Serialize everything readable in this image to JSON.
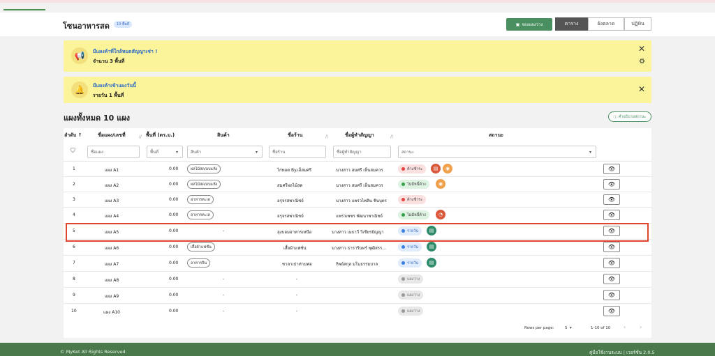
{
  "header": {
    "title": "โซนอาหารสด",
    "badge": "10 พื้นที่",
    "book_label": "จองแผงว่าง",
    "views": [
      "ตาราง",
      "ผังตลาด",
      "ปฏิทิน"
    ]
  },
  "banners": [
    {
      "title": "มีแผงค้าที่ใกล้หมดสัญญาเช่า !",
      "subtitle": "จำนวน 3 พื้นที่",
      "icon": "megaphone-icon"
    },
    {
      "title": "มีแผงค้าเข้าแผงวันนี้",
      "subtitle": "รายวัน 1 พื้นที่",
      "icon": "bell-icon"
    }
  ],
  "section": {
    "title": "แผงทั้งหมด 10 แผง",
    "help_label": "คำอธิบายสถานะ"
  },
  "table": {
    "headers": {
      "order": "ลำดับ ↑",
      "stall": "ชื่อแผง/เลขที่",
      "area": "พื้นที่ (ตร.ม.)",
      "goods": "สินค้า",
      "shop": "ชื่อร้าน",
      "tenant": "ชื่อผู้ทำสัญญา",
      "status": "สถานะ"
    },
    "filters": {
      "stall": "ชื่อแผง",
      "area": "พื้นที่",
      "goods": "สินค้า",
      "shop": "ชื่อร้าน",
      "tenant": "ชื่อผู้ทำสัญญา",
      "status": "สถานะ"
    },
    "rows": [
      {
        "no": "1",
        "stall": "แผง A1",
        "area": "0.00",
        "goods": "ผลไม้สด/อบแห้ง",
        "shop": "ไก่ทอด By.เอ็สมศรี",
        "tenant": "นางสาว สมศรี เห็นสมควร",
        "status": "ค้างชำระ",
        "st": "pay"
      },
      {
        "no": "2",
        "stall": "แผง A2",
        "area": "0.00",
        "goods": "ผลไม้สด/อบแห้ง",
        "shop": "สมศรีผลไม้สด",
        "tenant": "นางสาว สมศรี เห็นสมควร",
        "status": "ไม่มีหนี้ค้าง",
        "st": "ok"
      },
      {
        "no": "3",
        "stall": "แผง A3",
        "area": "0.00",
        "goods": "อาหารทะเล",
        "shop": "อรุจรสพาณิชย์",
        "tenant": "นางสาว แพรวไพลิน ชินบุตร",
        "status": "ค้างชำระ",
        "st": "pay"
      },
      {
        "no": "4",
        "stall": "แผง A4",
        "area": "0.00",
        "goods": "อาหารทะเล",
        "shop": "อรุจรสพาณิชย์",
        "tenant": "แพรวเพชร พัฒนาพาณิชย์",
        "status": "ไม่มีหนี้ค้าง",
        "st": "ok"
      },
      {
        "no": "5",
        "stall": "แผง A5",
        "area": "0.00",
        "goods": "-",
        "shop": "ลุงบอมอาหารเหนือ",
        "tenant": "นางสาว เมธาวี วิเชียรปัญญา",
        "status": "รายวัน",
        "st": "day"
      },
      {
        "no": "6",
        "stall": "แผง A6",
        "area": "0.00",
        "goods": "เสื้อผ้าแฟชั่น",
        "shop": "เสื้อผ้าแฟชั่น",
        "tenant": "นางสาว ธารารินทร์ พุฒิสรร...",
        "status": "รายวัน",
        "st": "day"
      },
      {
        "no": "7",
        "stall": "แผง A7",
        "area": "0.00",
        "goods": "อาหารจีน",
        "shop": "ซาลาเปาท่านพ่อ",
        "tenant": "กิพย์สกุล มโนธรรมบาล",
        "status": "รายวัน",
        "st": "day"
      },
      {
        "no": "8",
        "stall": "แผง A8",
        "area": "0.00",
        "goods": "-",
        "shop": "-",
        "tenant": "",
        "status": "แผงว่าง",
        "st": "empty"
      },
      {
        "no": "9",
        "stall": "แผง A9",
        "area": "0.00",
        "goods": "-",
        "shop": "-",
        "tenant": "",
        "status": "แผงว่าง",
        "st": "empty"
      },
      {
        "no": "10",
        "stall": "แผง A10",
        "area": "0.00",
        "goods": "-",
        "shop": "-",
        "tenant": "",
        "status": "แผงว่าง",
        "st": "empty"
      }
    ]
  },
  "pager": {
    "rows_label": "Rows per page:",
    "rows_value": "5",
    "range": "1-10 of 10"
  },
  "footer": {
    "copyright": "© MyKet All Rights Reserved.",
    "right": "คู่มือใช้งานระบบ | เวอร์ชั่น 2.0.5"
  }
}
